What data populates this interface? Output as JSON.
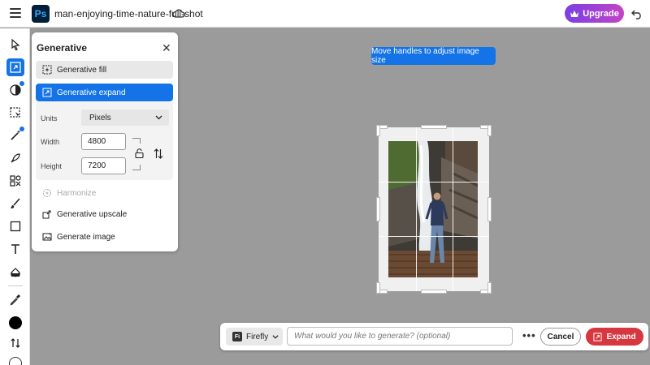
{
  "topbar": {
    "app_logo_text": "Ps",
    "document_title": "man-enjoying-time-nature-full-shot",
    "upgrade_label": "Upgrade"
  },
  "panel": {
    "title": "Generative",
    "items": [
      {
        "label": "Generative fill",
        "icon": "generative-fill-icon",
        "state": "hover"
      },
      {
        "label": "Generative expand",
        "icon": "generative-expand-icon",
        "state": "selected"
      },
      {
        "label": "Harmonize",
        "icon": "harmonize-icon",
        "state": "disabled"
      },
      {
        "label": "Generative upscale",
        "icon": "generative-upscale-icon",
        "state": "normal"
      },
      {
        "label": "Generate image",
        "icon": "generate-image-icon",
        "state": "normal"
      }
    ],
    "units_label": "Units",
    "units_value": "Pixels",
    "width_label": "Width",
    "width_value": "4800",
    "height_label": "Height",
    "height_value": "7200"
  },
  "tooltip": "Move handles to adjust image size",
  "prompt_bar": {
    "model_label": "Firefly",
    "model_logo": "Fi",
    "input_placeholder": "What would you like to generate? (optional)",
    "cancel_label": "Cancel",
    "expand_label": "Expand"
  },
  "colors": {
    "accent": "#1473e6",
    "expand_button": "#d7373f",
    "canvas_background": "#9b9b9b",
    "upgrade_gradient_start": "#7b3fe4",
    "upgrade_gradient_end": "#c243c7"
  }
}
